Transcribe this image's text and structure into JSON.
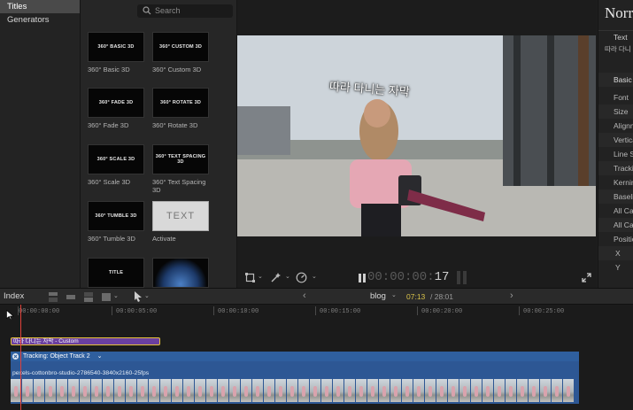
{
  "sidebar": {
    "items": [
      {
        "label": "Titles",
        "selected": true
      },
      {
        "label": "Generators",
        "selected": false
      }
    ]
  },
  "browser": {
    "search_placeholder": "Search",
    "tiles": [
      {
        "thumb": "360° BASIC 3D",
        "label": "360° Basic 3D"
      },
      {
        "thumb": "360° CUSTOM 3D",
        "label": "360° Custom 3D"
      },
      {
        "thumb": "360° FADE 3D",
        "label": "360° Fade 3D"
      },
      {
        "thumb": "360° ROTATE 3D",
        "label": "360° Rotate 3D"
      },
      {
        "thumb": "360° SCALE 3D",
        "label": "360° Scale 3D"
      },
      {
        "thumb": "360° TEXT SPACING 3D",
        "label": "360° Text Spacing 3D"
      },
      {
        "thumb": "360° TUMBLE 3D",
        "label": "360° Tumble 3D"
      },
      {
        "thumb": "TEXT",
        "label": "Activate"
      },
      {
        "thumb": "TITLE",
        "label": ""
      },
      {
        "thumb": "",
        "label": ""
      }
    ]
  },
  "viewer": {
    "caption": "따라 다니는 자막",
    "timecode_dim": "00:00:00:",
    "timecode_frames": "17"
  },
  "inspector": {
    "title": "Norr",
    "text_label": "Text",
    "text_value": "따라 다니",
    "rows": [
      "Basic",
      "Font",
      "Size",
      "Alignm",
      "Vertica",
      "Line S",
      "Trackin",
      "Kernin",
      "Baseli",
      "All Ca",
      "All Ca",
      "Positio",
      "X",
      "Y"
    ]
  },
  "timeline_bar": {
    "index_label": "Index",
    "project": "blog",
    "position": "07:13",
    "duration": "/ 28:01"
  },
  "ruler": [
    "00:00:00:00",
    "00:00:05:00",
    "00:00:10:00",
    "00:00:15:00",
    "00:00:20:00",
    "00:00:25:00"
  ],
  "clips": {
    "title_clip": "따라 다니는 자막 - Custom",
    "tracking": "Tracking: Object Track 2",
    "video_clip": "pexels-cottonbro-studio-2786540-3840x2160-25fps"
  },
  "colors": {
    "accent": "#e6c23a",
    "title_clip": "#6a3fa0",
    "video_clip": "#2d5794",
    "playhead": "#e0413a",
    "position": "#d8c24a"
  }
}
